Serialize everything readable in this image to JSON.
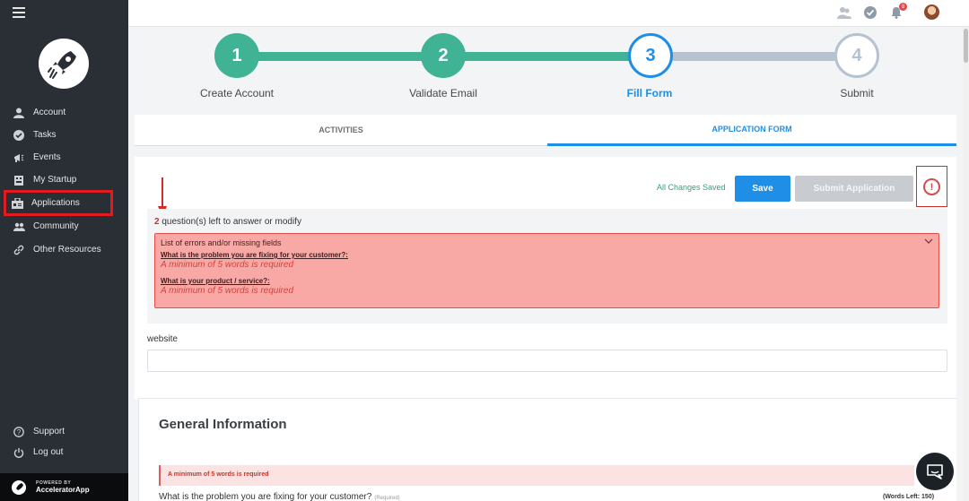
{
  "sidebar": {
    "items": [
      {
        "label": "Account",
        "icon": "user-icon"
      },
      {
        "label": "Tasks",
        "icon": "check-circle-icon"
      },
      {
        "label": "Events",
        "icon": "megaphone-icon"
      },
      {
        "label": "My Startup",
        "icon": "building-icon"
      },
      {
        "label": "Applications",
        "icon": "applications-icon"
      },
      {
        "label": "Community",
        "icon": "community-icon"
      },
      {
        "label": "Other Resources",
        "icon": "link-icon"
      },
      {
        "label": "Support",
        "icon": "help-icon"
      },
      {
        "label": "Log out",
        "icon": "power-icon"
      }
    ],
    "active_item": "Applications",
    "powered_by": "POWERED BY",
    "brand": "AcceleratorApp"
  },
  "topbar": {
    "notification_count": "8"
  },
  "stepper": {
    "steps": [
      {
        "number": "1",
        "label": "Create Account",
        "state": "done"
      },
      {
        "number": "2",
        "label": "Validate Email",
        "state": "done"
      },
      {
        "number": "3",
        "label": "Fill Form",
        "state": "current"
      },
      {
        "number": "4",
        "label": "Submit",
        "state": "pending"
      }
    ]
  },
  "tabs": [
    {
      "label": "ACTIVITIES",
      "active": false
    },
    {
      "label": "APPLICATION FORM",
      "active": true
    }
  ],
  "form": {
    "save_status": "All Changes Saved",
    "save_label": "Save",
    "submit_label": "Submit Application",
    "questions_left_count": "2",
    "questions_left_text": " question(s) left to answer or modify",
    "errors_title": "List of errors and/or missing fields",
    "errors": [
      {
        "question": "What is the problem you are fixing for your customer?:",
        "message": "A minimum of 5 words is required"
      },
      {
        "question": "What is your product / service?:",
        "message": "A minimum of 5 words is required"
      }
    ],
    "website_label": "website",
    "website_value": ""
  },
  "general": {
    "title": "General Information",
    "error_message": "A minimum of 5 words is required",
    "question": "What is the problem you are fixing for your customer?",
    "required": "(Required)",
    "words_left": "(Words Left: 150)"
  },
  "colors": {
    "sidebar_bg": "#2a2e35",
    "step_done": "#3fb394",
    "step_current": "#1f8ee6",
    "step_pending": "#b7c2d0",
    "error_bg": "#f8a9a6",
    "alert_red": "#d32a2a"
  }
}
